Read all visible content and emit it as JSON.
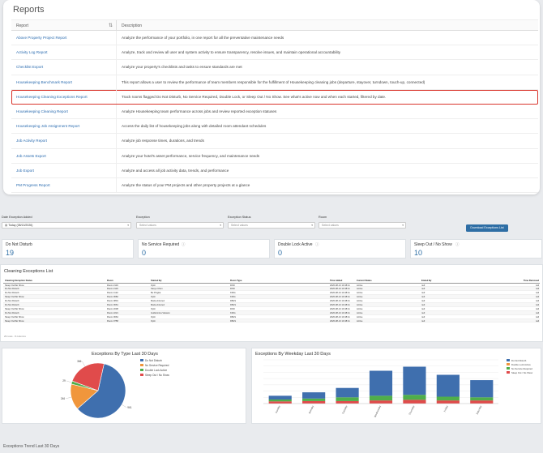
{
  "reports": {
    "title": "Reports",
    "columns": {
      "report": "Report",
      "description": "Description"
    },
    "rows": [
      {
        "name": "Above Property Project Report",
        "description": "Analyze the performance of your portfolio, in one report for all the preventative maintenance needs"
      },
      {
        "name": "Activity Log Report",
        "description": "Analyze, track and review all user and system activity to ensure transparency, resolve issues, and maintain operational accountability"
      },
      {
        "name": "Checklist Export",
        "description": "Analyze your property's checklists and tasks to ensure standards are met"
      },
      {
        "name": "Housekeeping Benchmark Report",
        "description": "This report allows a user to review the performance of team members responsible for the fulfillment of Housekeeping cleaning jobs (departure, stayover, turndown, touch-up, connected)"
      },
      {
        "name": "Housekeeping Cleaning Exceptions Report",
        "description": "Track rooms flagged Do Not Disturb, No Service Required, Double Lock, or Sleep Out / No Show. See what's active now and when each started, filtered by date."
      },
      {
        "name": "Housekeeping Cleaning Report",
        "description": "Analyze Housekeeping team performance across jobs and review reported exception statuses"
      },
      {
        "name": "Housekeeping Job Assignment Report",
        "description": "Access the daily list of housekeeping jobs along with detailed room attendant schedules"
      },
      {
        "name": "Job Activity Report",
        "description": "Analyze job response times, durations, and trends"
      },
      {
        "name": "Job Assets Export",
        "description": "Analyze your hotel's asset performance, service frequency, and maintenance needs"
      },
      {
        "name": "Job Export",
        "description": "Analyze and access all job activity data, trends, and performance"
      },
      {
        "name": "PM Progress Report",
        "description": "Analyze the status of your PM projects and other property projects at a glance"
      }
    ]
  },
  "filters": {
    "date_label": "Date Exception Added",
    "date_value": "Today (08/13/2026)",
    "exception_label": "Exception",
    "exception_placeholder": "Select values",
    "status_label": "Exception Status",
    "status_placeholder": "Select values",
    "room_label": "Room",
    "room_placeholder": "Select values",
    "download_label": "Download Exceptions List"
  },
  "stats": [
    {
      "label": "Do Not Disturb",
      "value": "19"
    },
    {
      "label": "No Service Required",
      "value": "0"
    },
    {
      "label": "Double Lock Active",
      "value": "0"
    },
    {
      "label": "Sleep Out / No Show",
      "value": "10"
    }
  ],
  "exceptions_list": {
    "title": "Cleaning Exceptions List",
    "columns": [
      "Cleaning Exception Status",
      "Room",
      "Started By",
      "Room Type",
      "Time Added",
      "Current Status",
      "Ended By",
      "Time Removed"
    ],
    "rows": [
      [
        "Sleep Out/No Show",
        "Room 2119",
        "Optii",
        "DKD",
        "2026-08-13 10:48:11",
        "Active",
        "null",
        "null"
      ],
      [
        "Do Not Disturb",
        "Room 2119",
        "Kasyo Chen",
        "DKD",
        "2026-08-13 10:48:11",
        "Active",
        "null",
        "null"
      ],
      [
        "Do Not Disturb",
        "Room 1122",
        "Bu Pingtia",
        "KING",
        "2026-08-13 10:48:11",
        "Active",
        "null",
        "null"
      ],
      [
        "Sleep Out/No Show",
        "Room 0682",
        "Optii",
        "KING",
        "2026-08-13 10:48:11",
        "Active",
        "null",
        "null"
      ],
      [
        "Do Not Disturb",
        "Room 0801",
        "Maria Antunez",
        "DBLS",
        "2026-08-13 10:48:11",
        "Active",
        "null",
        "null"
      ],
      [
        "Do Not Disturb",
        "Room 0661",
        "Maria Antunez",
        "DBLS",
        "2026-08-13 10:48:11",
        "Active",
        "null",
        "null"
      ],
      [
        "Sleep Out/No Show",
        "Room 2038",
        "Optii",
        "DKD",
        "2026-08-13 10:48:11",
        "Active",
        "null",
        "null"
      ],
      [
        "Do Not Disturb",
        "Room 2221",
        "Guillermina Velasco",
        "KING",
        "2026-08-13 10:48:11",
        "Active",
        "null",
        "null"
      ],
      [
        "Sleep Out/No Show",
        "Room 0664",
        "Optii",
        "DBLS",
        "2026-08-13 10:48:11",
        "Active",
        "null",
        "null"
      ],
      [
        "Sleep Out/No Show",
        "Room 0758",
        "Optii",
        "DBLS",
        "2026-08-13 10:48:11",
        "Active",
        "null",
        "null"
      ]
    ],
    "footer": "29 rows · 8 columns"
  },
  "pie_chart": {
    "title": "Exceptions By Type Last 30 Days",
    "chart_data": {
      "type": "pie",
      "title": "Exceptions By Type Last 30 Days",
      "legend": "right",
      "slices": [
        {
          "name": "Do Not Disturb",
          "value": 961,
          "color": "#3f6fae"
        },
        {
          "name": "No Service Required",
          "value": 246,
          "color": "#f0963c"
        },
        {
          "name": "Double Lock Active",
          "value": 29,
          "color": "#4fae4a"
        },
        {
          "name": "Sleep Out / No Show",
          "value": 366,
          "color": "#e04b4b"
        }
      ]
    }
  },
  "bar_chart": {
    "title": "Exceptions By Weekday Last 30 Days",
    "chart_data": {
      "type": "bar",
      "stacked": true,
      "title": "Exceptions By Weekday Last 30 Days",
      "legend": "right",
      "ylim": [
        0,
        140
      ],
      "categories": [
        "Sunday",
        "Monday",
        "Tuesday",
        "Wednesday",
        "Thursday",
        "Friday",
        "Saturday"
      ],
      "series": [
        {
          "name": "Do Not Disturb",
          "color": "#3f6fae",
          "values": [
            12,
            20,
            30,
            80,
            90,
            70,
            55
          ]
        },
        {
          "name": "Double Lock Active",
          "color": "#f0963c",
          "values": [
            0,
            0,
            0,
            0,
            0,
            0,
            0
          ]
        },
        {
          "name": "No Service Required",
          "color": "#4fae4a",
          "values": [
            6,
            8,
            12,
            15,
            16,
            12,
            10
          ]
        },
        {
          "name": "Sleep Out / No Show",
          "color": "#e04b4b",
          "values": [
            7,
            8,
            8,
            10,
            12,
            10,
            10
          ]
        }
      ]
    }
  },
  "bottom": {
    "title": "Exceptions Trend Last 30 Days"
  }
}
